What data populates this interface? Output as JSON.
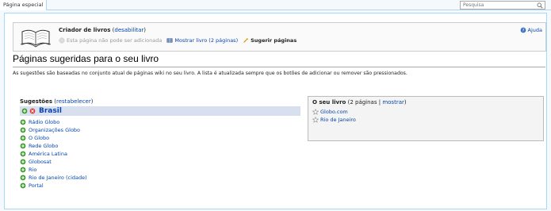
{
  "tabs": {
    "special_page": "Página especial"
  },
  "search": {
    "placeholder": "Pesquisa"
  },
  "book_creator": {
    "title": "Criador de livros",
    "disable_link": "desabilitar",
    "cannot_add": "Esta página não pode ser adicionada",
    "show_book": "Mostrar livro (2 páginas)",
    "suggest_pages": "Sugerir páginas",
    "help": "Ajuda"
  },
  "page": {
    "title": "Páginas sugeridas para o seu livro",
    "intro": "As sugestões são baseadas no conjunto atual de páginas wiki no seu livro. A lista é atualizada sempre que os botões de adicionar ou remover são pressionados."
  },
  "suggestions": {
    "label": "Sugestões",
    "reset_link": "restabelecer",
    "featured": "Brasil",
    "items": [
      "Rádio Globo",
      "Organizações Globo",
      "O Globo",
      "Rede Globo",
      "América Latina",
      "Globosat",
      "Rio",
      "Rio de Janeiro (cidade)",
      "Portal"
    ]
  },
  "my_book": {
    "label": "O seu livro",
    "count": "(2 páginas |",
    "show_link": "mostrar",
    "close_paren": ")",
    "items": [
      "Globo.com",
      "Rio de Janeiro"
    ]
  },
  "colors": {
    "link": "#0645ad",
    "border": "#a7d7f9",
    "featured_bg": "#d8e0f0",
    "add_green": "#3a9a2a",
    "remove_red": "#d33"
  },
  "icons": [
    "search-icon",
    "book-icon",
    "remove-icon",
    "show-book-icon",
    "suggest-icon",
    "help-icon",
    "add-icon",
    "star-icon"
  ]
}
